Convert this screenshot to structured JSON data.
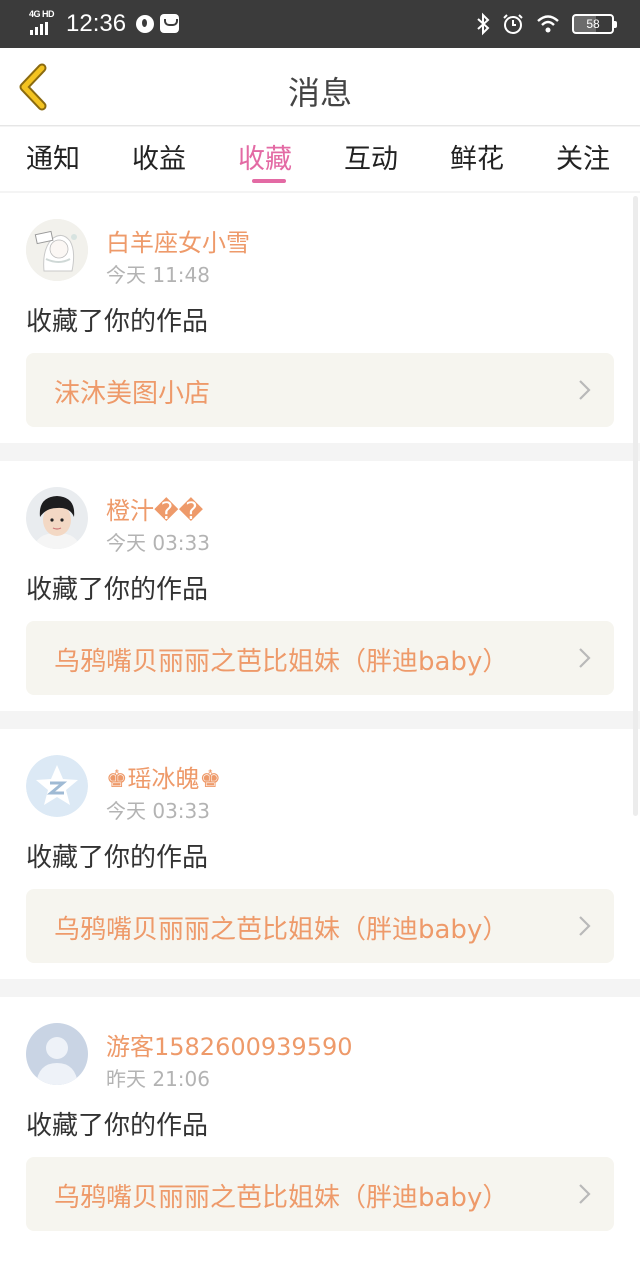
{
  "status_bar": {
    "network": "4G HD",
    "time": "12:36",
    "battery": "58"
  },
  "header": {
    "title": "消息",
    "back_icon": "chevron-left-icon",
    "back_color": "#e0b21c"
  },
  "tabs": [
    {
      "label": "通知"
    },
    {
      "label": "收益"
    },
    {
      "label": "收藏",
      "active": true
    },
    {
      "label": "互动"
    },
    {
      "label": "鲜花"
    },
    {
      "label": "关注"
    }
  ],
  "colors": {
    "accent_pink": "#e36aa4",
    "name_orange": "#ee9a6a",
    "link_background": "#f6f5ef"
  },
  "messages": [
    {
      "user": "白羊座女小雪",
      "time": "今天 11:48",
      "text": "收藏了你的作品",
      "work": "沫沐美图小店",
      "avatar": "sketch-girl-avatar"
    },
    {
      "user": "橙汁��",
      "time": "今天 03:33",
      "text": "收藏了你的作品",
      "work": "乌鸦嘴贝丽丽之芭比姐妹（胖迪baby）",
      "avatar": "boy-photo-avatar"
    },
    {
      "user": "♚瑶冰魄♚",
      "time": "今天 03:33",
      "text": "收藏了你的作品",
      "work": "乌鸦嘴贝丽丽之芭比姐妹（胖迪baby）",
      "avatar": "qzone-star-avatar"
    },
    {
      "user": "游客1582600939590",
      "time": "昨天 21:06",
      "text": "收藏了你的作品",
      "work": "乌鸦嘴贝丽丽之芭比姐妹（胖迪baby）",
      "avatar": "default-user-avatar"
    }
  ]
}
